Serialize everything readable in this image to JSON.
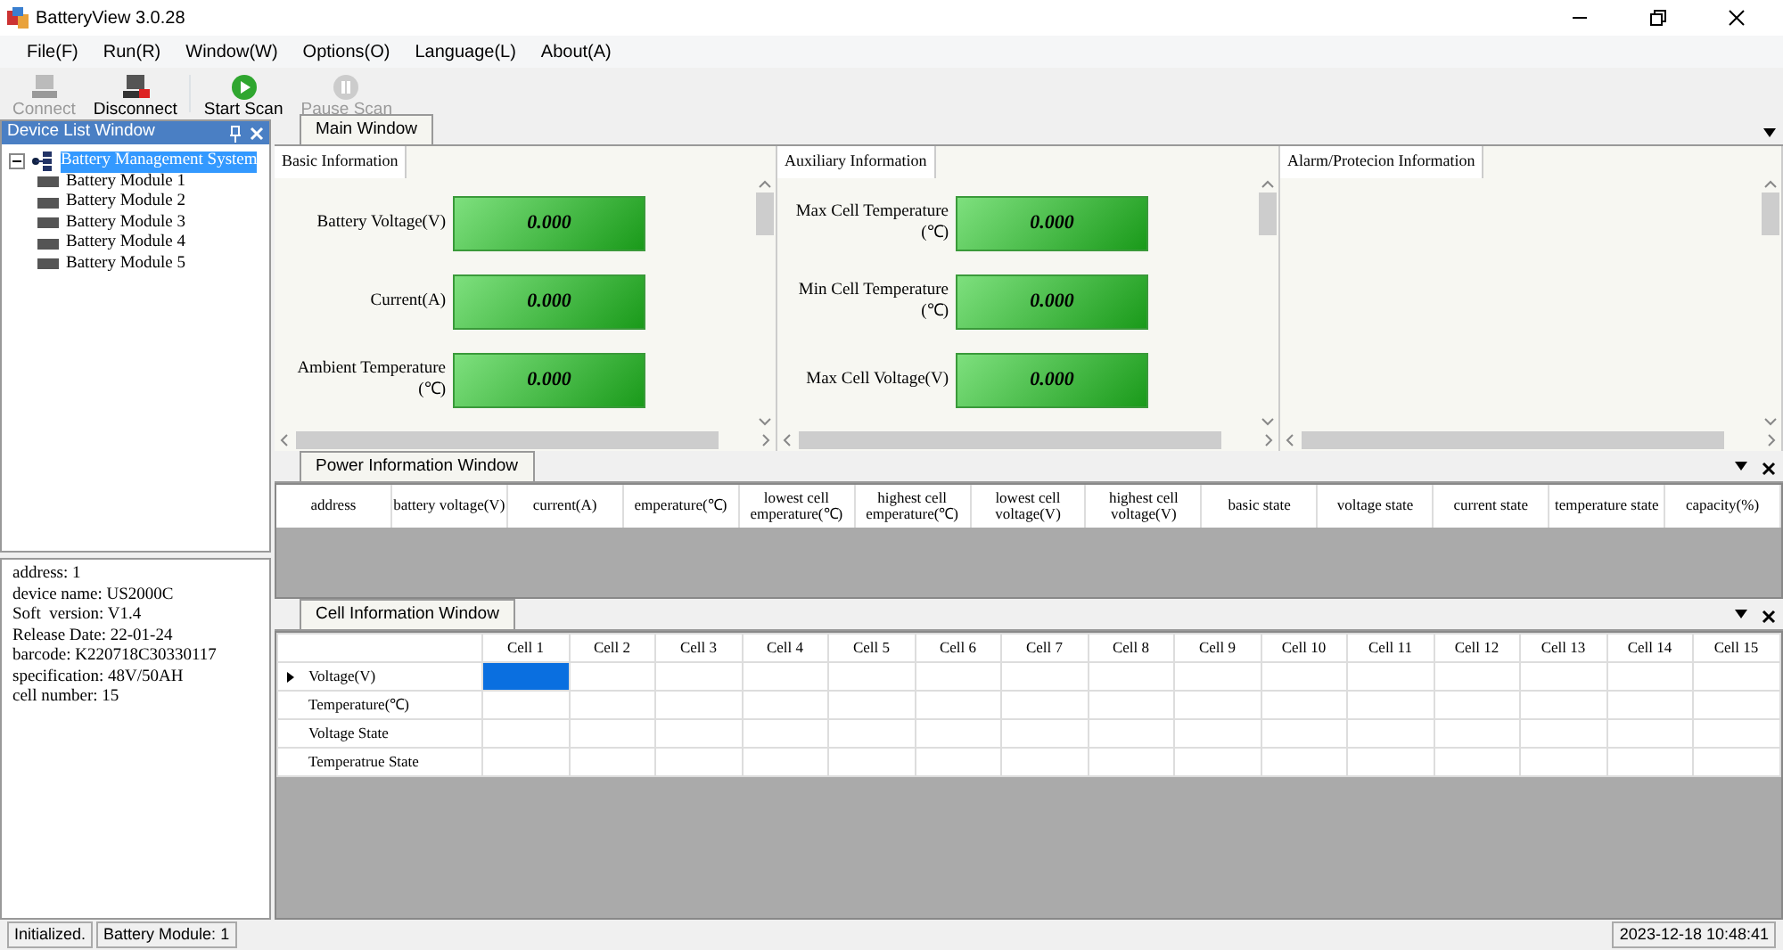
{
  "window": {
    "title": "BatteryView 3.0.28"
  },
  "menu": [
    "File(F)",
    "Run(R)",
    "Window(W)",
    "Options(O)",
    "Language(L)",
    "About(A)"
  ],
  "toolbar": [
    {
      "kind": "connect",
      "label": "Connect",
      "disabled": true
    },
    {
      "kind": "disconnect",
      "label": "Disconnect",
      "disabled": false
    },
    {
      "kind": "start",
      "label": "Start Scan",
      "disabled": false
    },
    {
      "kind": "pause",
      "label": "Pause Scan",
      "disabled": true
    }
  ],
  "device_list": {
    "title": "Device List Window",
    "tree": [
      {
        "label": "Battery Management System",
        "selected": true,
        "expanded": true,
        "children": [
          {
            "label": "Battery Module 1",
            "selected": false
          },
          {
            "label": "Battery Module 2",
            "selected": false
          },
          {
            "label": "Battery Module 3",
            "selected": false
          },
          {
            "label": "Battery Module 4",
            "selected": false
          },
          {
            "label": "Battery Module 5",
            "selected": false
          }
        ]
      }
    ]
  },
  "device_info": [
    "address: 1",
    "device name: US2000C",
    "Soft  version: V1.4",
    "Release Date: 22-01-24",
    "barcode: K220718C30330117",
    "specification: 48V/50AH",
    "cell number: 15"
  ],
  "main_window": {
    "tab": "Main Window",
    "panels": [
      {
        "title": "Basic Information",
        "metrics": [
          {
            "label": "Battery Voltage(V)",
            "value": "0.000"
          },
          {
            "label": "Current(A)",
            "value": "0.000"
          },
          {
            "label": "Ambient Temperature (℃)",
            "value": "0.000"
          }
        ]
      },
      {
        "title": "Auxiliary Information",
        "metrics": [
          {
            "label": "Max Cell Temperature (℃)",
            "value": "0.000"
          },
          {
            "label": "Min Cell Temperature (℃)",
            "value": "0.000"
          },
          {
            "label": "Max Cell Voltage(V)",
            "value": "0.000"
          }
        ]
      },
      {
        "title": "Alarm/Protecion Information"
      }
    ]
  },
  "power_window": {
    "tab": "Power Information Window",
    "columns": [
      "address",
      "battery voltage(V)",
      "current(A)",
      "emperature(℃)",
      "lowest cell emperature(℃)",
      "highest cell emperature(℃)",
      "lowest cell voltage(V)",
      "highest cell voltage(V)",
      "basic state",
      "voltage state",
      "current state",
      "temperature state",
      "capacity(%)"
    ]
  },
  "cell_window": {
    "tab": "Cell Information Window",
    "columns": [
      "Cell 1",
      "Cell 2",
      "Cell 3",
      "Cell 4",
      "Cell 5",
      "Cell 6",
      "Cell 7",
      "Cell 8",
      "Cell 9",
      "Cell 10",
      "Cell 11",
      "Cell 12",
      "Cell 13",
      "Cell 14",
      "Cell 15"
    ],
    "rows": [
      {
        "label": "Voltage(V)",
        "current": true,
        "cells": [
          {
            "selected": true
          },
          {
            "selected": false
          },
          {
            "selected": false
          },
          {
            "selected": false
          },
          {
            "selected": false
          },
          {
            "selected": false
          },
          {
            "selected": false
          },
          {
            "selected": false
          },
          {
            "selected": false
          },
          {
            "selected": false
          },
          {
            "selected": false
          },
          {
            "selected": false
          },
          {
            "selected": false
          },
          {
            "selected": false
          },
          {
            "selected": false
          }
        ]
      },
      {
        "label": "Temperature(℃)",
        "current": false,
        "cells": [
          {
            "selected": false
          },
          {
            "selected": false
          },
          {
            "selected": false
          },
          {
            "selected": false
          },
          {
            "selected": false
          },
          {
            "selected": false
          },
          {
            "selected": false
          },
          {
            "selected": false
          },
          {
            "selected": false
          },
          {
            "selected": false
          },
          {
            "selected": false
          },
          {
            "selected": false
          },
          {
            "selected": false
          },
          {
            "selected": false
          },
          {
            "selected": false
          }
        ]
      },
      {
        "label": "Voltage State",
        "current": false,
        "cells": [
          {
            "selected": false
          },
          {
            "selected": false
          },
          {
            "selected": false
          },
          {
            "selected": false
          },
          {
            "selected": false
          },
          {
            "selected": false
          },
          {
            "selected": false
          },
          {
            "selected": false
          },
          {
            "selected": false
          },
          {
            "selected": false
          },
          {
            "selected": false
          },
          {
            "selected": false
          },
          {
            "selected": false
          },
          {
            "selected": false
          },
          {
            "selected": false
          }
        ]
      },
      {
        "label": "Temperatrue State",
        "current": false,
        "cells": [
          {
            "selected": false
          },
          {
            "selected": false
          },
          {
            "selected": false
          },
          {
            "selected": false
          },
          {
            "selected": false
          },
          {
            "selected": false
          },
          {
            "selected": false
          },
          {
            "selected": false
          },
          {
            "selected": false
          },
          {
            "selected": false
          },
          {
            "selected": false
          },
          {
            "selected": false
          },
          {
            "selected": false
          },
          {
            "selected": false
          },
          {
            "selected": false
          }
        ]
      }
    ]
  },
  "status_bar": [
    "Initialized.",
    "Battery Module: 1",
    "2023-12-18 10:48:41"
  ]
}
